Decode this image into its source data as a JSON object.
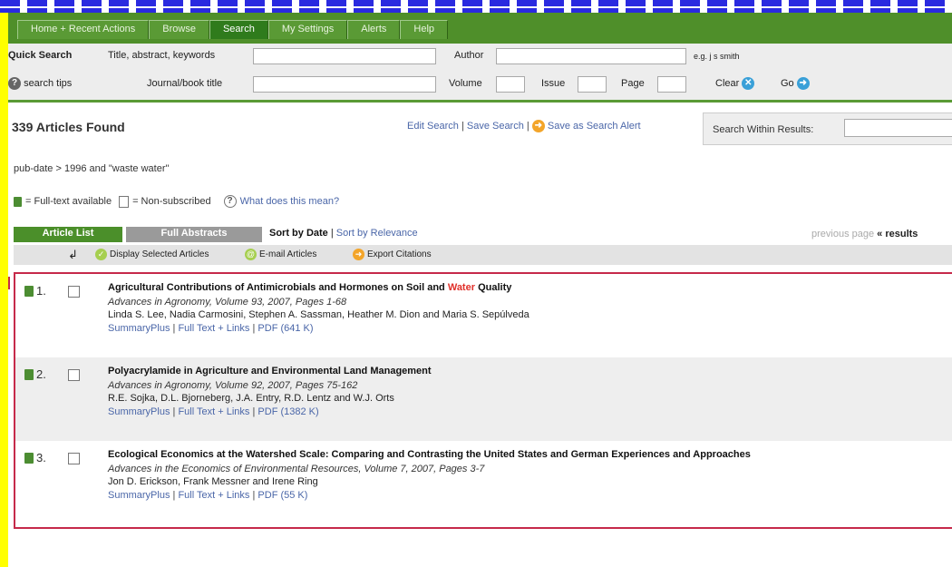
{
  "nav": {
    "tabs": [
      {
        "label": "Home + Recent Actions",
        "active": false
      },
      {
        "label": "Browse",
        "active": false
      },
      {
        "label": "Search",
        "active": true
      },
      {
        "label": "My Settings",
        "active": false
      },
      {
        "label": "Alerts",
        "active": false
      },
      {
        "label": "Help",
        "active": false
      }
    ]
  },
  "quick_search": {
    "title": "Quick Search",
    "field1_label": "Title, abstract, keywords",
    "author_label": "Author",
    "author_hint": "e.g. j s smith",
    "tips_label": "search tips",
    "journal_label": "Journal/book title",
    "volume_label": "Volume",
    "issue_label": "Issue",
    "page_label": "Page",
    "clear_label": "Clear",
    "go_label": "Go"
  },
  "results": {
    "count_text": "339 Articles Found",
    "edit_search": "Edit Search",
    "save_search": "Save Search",
    "save_alert": "Save as Search Alert",
    "search_within_label": "Search Within Results:"
  },
  "query_line": "pub-date > 1996 and \"waste water\"",
  "legend": {
    "fulltext": "= Full-text available",
    "nonsub": "= Non-subscribed",
    "what": "What does this mean?"
  },
  "list_tabs": {
    "article_list": "Article List",
    "full_abstracts": "Full Abstracts",
    "sort_date": "Sort by Date",
    "sort_relevance": "Sort by Relevance",
    "prev_page": "previous page",
    "results": "« results"
  },
  "actions": {
    "display": "Display Selected Articles",
    "email": "E-mail Articles",
    "export": "Export Citations"
  },
  "articles": [
    {
      "num": "1.",
      "title_before": "Agricultural Contributions of Antimicrobials and Hormones on Soil and",
      "title_highlight": "Water",
      "title_after": "Quality",
      "source": "Advances in Agronomy, Volume 93, 2007, Pages 1-68",
      "authors": "Linda S. Lee, Nadia Carmosini, Stephen A. Sassman, Heather M. Dion and Maria S. Sepúlveda",
      "summary": "SummaryPlus",
      "fulltext": "Full Text + Links",
      "pdf": "PDF (641 K)"
    },
    {
      "num": "2.",
      "title_before": "Polyacrylamide in Agriculture and Environmental Land Management",
      "title_highlight": "",
      "title_after": "",
      "source": "Advances in Agronomy, Volume 92, 2007, Pages 75-162",
      "authors": "R.E. Sojka, D.L. Bjorneberg, J.A. Entry, R.D. Lentz and W.J. Orts",
      "summary": "SummaryPlus",
      "fulltext": "Full Text + Links",
      "pdf": "PDF (1382 K)"
    },
    {
      "num": "3.",
      "title_before": "Ecological Economics at the Watershed Scale: Comparing and Contrasting the United States and German Experiences and Approaches",
      "title_highlight": "",
      "title_after": "",
      "source": "Advances in the Economics of Environmental Resources, Volume 7, 2007, Pages 3-7",
      "authors": "Jon D. Erickson, Frank Messner and Irene Ring",
      "summary": "SummaryPlus",
      "fulltext": "Full Text + Links",
      "pdf": "PDF (55 K)"
    }
  ]
}
